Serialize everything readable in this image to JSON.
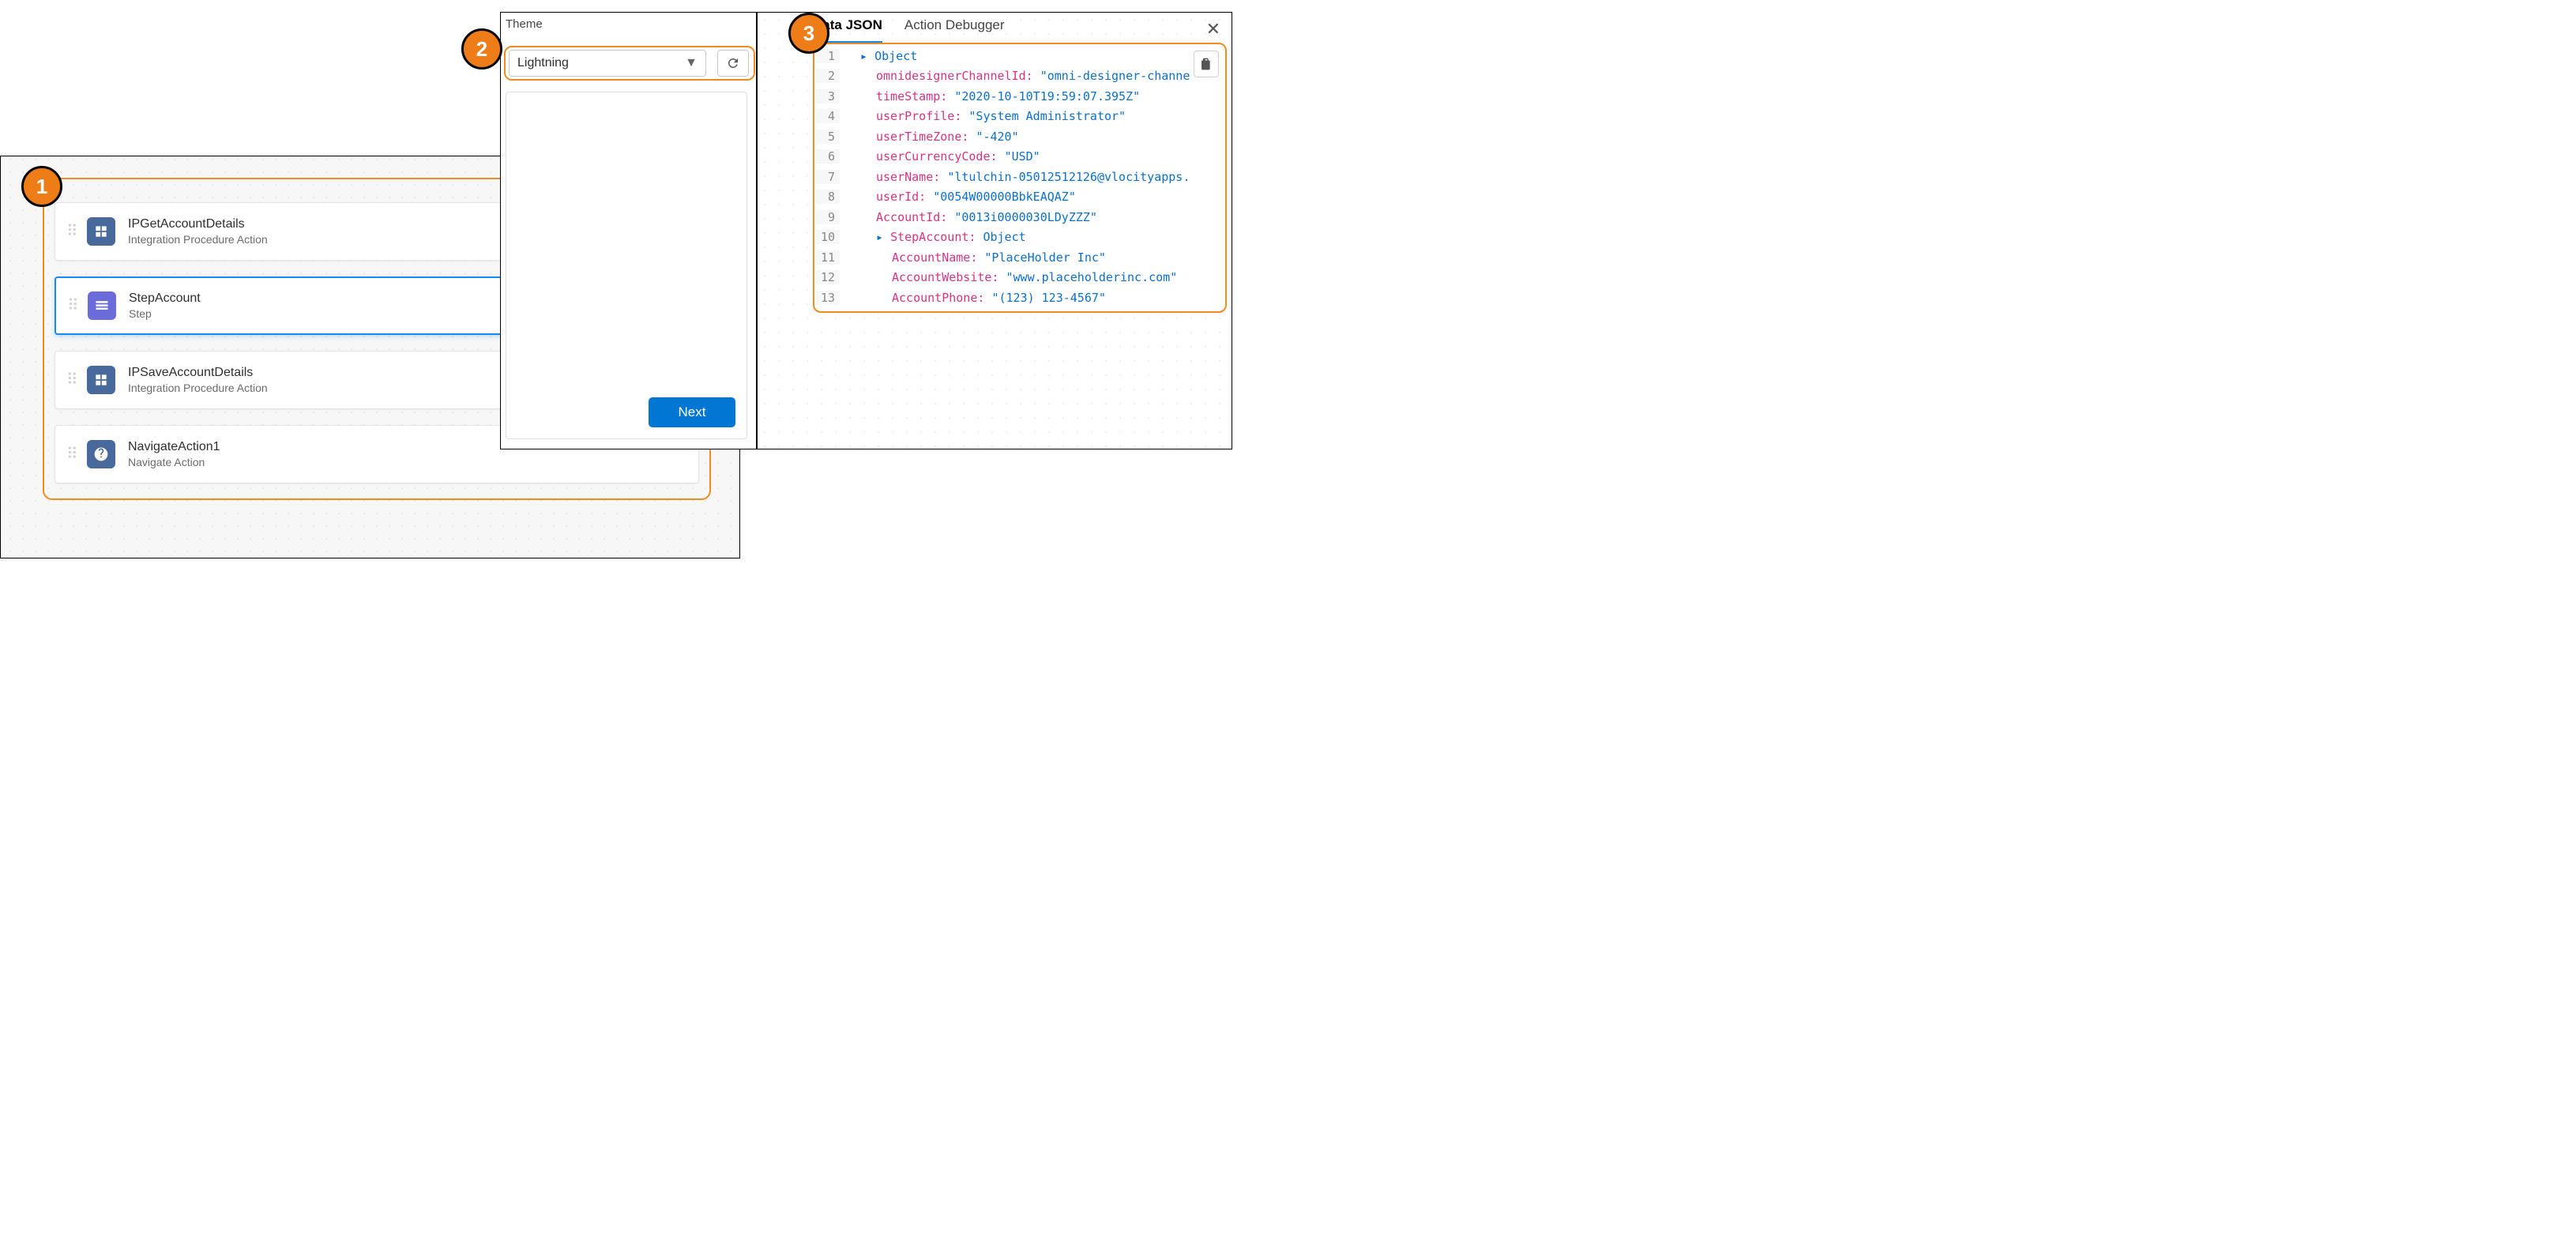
{
  "steps": {
    "items": [
      {
        "title": "IPGetAccountDetails",
        "subtitle": "Integration Procedure Action",
        "icon": "ip",
        "selected": false
      },
      {
        "title": "StepAccount",
        "subtitle": "Step",
        "icon": "step",
        "selected": true
      },
      {
        "title": "IPSaveAccountDetails",
        "subtitle": "Integration Procedure Action",
        "icon": "ip",
        "selected": false
      },
      {
        "title": "NavigateAction1",
        "subtitle": "Navigate Action",
        "icon": "nav",
        "selected": false
      }
    ]
  },
  "preview": {
    "theme_label": "Theme",
    "theme_value": "Lightning",
    "next_label": "Next"
  },
  "json_panel": {
    "tabs": {
      "data_json": "Data JSON",
      "action_debugger": "Action Debugger"
    },
    "lines": [
      {
        "n": "1",
        "indent": 0,
        "twist": true,
        "key": "",
        "colon": false,
        "value": "Object",
        "valclass": "kw"
      },
      {
        "n": "2",
        "indent": 1,
        "twist": false,
        "key": "omnidesignerChannelId",
        "colon": true,
        "value": "\"omni-designer-channe",
        "valclass": "str"
      },
      {
        "n": "3",
        "indent": 1,
        "twist": false,
        "key": "timeStamp",
        "colon": true,
        "value": "\"2020-10-10T19:59:07.395Z\"",
        "valclass": "str"
      },
      {
        "n": "4",
        "indent": 1,
        "twist": false,
        "key": "userProfile",
        "colon": true,
        "value": "\"System Administrator\"",
        "valclass": "str"
      },
      {
        "n": "5",
        "indent": 1,
        "twist": false,
        "key": "userTimeZone",
        "colon": true,
        "value": "\"-420\"",
        "valclass": "str"
      },
      {
        "n": "6",
        "indent": 1,
        "twist": false,
        "key": "userCurrencyCode",
        "colon": true,
        "value": "\"USD\"",
        "valclass": "str"
      },
      {
        "n": "7",
        "indent": 1,
        "twist": false,
        "key": "userName",
        "colon": true,
        "value": "\"ltulchin-05012512126@vlocityapps.",
        "valclass": "str"
      },
      {
        "n": "8",
        "indent": 1,
        "twist": false,
        "key": "userId",
        "colon": true,
        "value": "\"0054W00000BbkEAQAZ\"",
        "valclass": "str"
      },
      {
        "n": "9",
        "indent": 1,
        "twist": false,
        "key": "AccountId",
        "colon": true,
        "value": "\"0013i0000030LDyZZZ\"",
        "valclass": "str"
      },
      {
        "n": "10",
        "indent": 1,
        "twist": true,
        "key": "StepAccount",
        "colon": true,
        "value": "Object",
        "valclass": "kw"
      },
      {
        "n": "11",
        "indent": 2,
        "twist": false,
        "key": "AccountName",
        "colon": true,
        "value": "\"PlaceHolder Inc\"",
        "valclass": "str"
      },
      {
        "n": "12",
        "indent": 2,
        "twist": false,
        "key": "AccountWebsite",
        "colon": true,
        "value": "\"www.placeholderinc.com\"",
        "valclass": "str"
      },
      {
        "n": "13",
        "indent": 2,
        "twist": false,
        "key": "AccountPhone",
        "colon": true,
        "value": "\"(123) 123-4567\"",
        "valclass": "str"
      }
    ]
  },
  "badges": {
    "one": "1",
    "two": "2",
    "three": "3"
  },
  "colors": {
    "accent": "#f08b1f",
    "brand": "#0176d3",
    "select": "#1589ee"
  }
}
